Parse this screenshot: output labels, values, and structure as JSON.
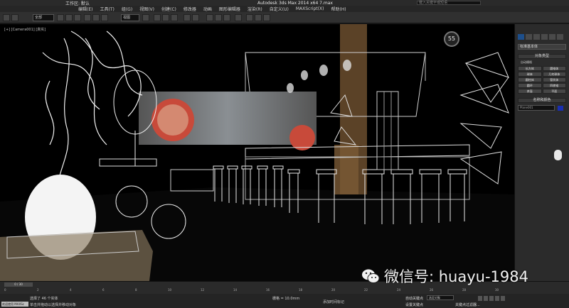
{
  "titlebar": {
    "workspace": "工作区: 默认",
    "title": "Autodesk 3ds Max 2014 x64   7.max",
    "search_placeholder": "键入关键字或短语"
  },
  "menu": {
    "items": [
      "编辑(E)",
      "工具(T)",
      "组(G)",
      "视图(V)",
      "创建(C)",
      "修改器",
      "动画",
      "图形编辑器",
      "渲染(R)",
      "自定义(U)",
      "MAXScript(X)",
      "帮助(H)"
    ]
  },
  "toolbar": {
    "selection_filter": "全部",
    "view_label": "视图"
  },
  "viewport": {
    "label": "[+] [Camera001] [真实]",
    "compass_value": "55"
  },
  "command_panel": {
    "category_dropdown": "标准基本体",
    "rollout_object_type": "对象类型",
    "autogrid": "自动栅格",
    "buttons": [
      "长方体",
      "圆锥体",
      "球体",
      "几何球体",
      "圆柱体",
      "管状体",
      "圆环",
      "四棱锥",
      "茶壶",
      "平面"
    ],
    "rollout_name_color": "名称和颜色",
    "name_value": "Plane001",
    "color": "#1a2fb0"
  },
  "timeline": {
    "frame_readout": "0 / 30",
    "ticks": [
      "0",
      "2",
      "4",
      "6",
      "8",
      "10",
      "12",
      "14",
      "16",
      "18",
      "20",
      "22",
      "24",
      "26",
      "28",
      "30"
    ]
  },
  "status": {
    "maxscript_label": "欢迎使用 MAXSc",
    "selected_count": "选择了 46 个实体",
    "prompt": "单击并拖动以选择并移动对象",
    "grid": "栅格 = 10.0mm",
    "add_time_tag": "添加时间标记",
    "auto_key": "自动关键点",
    "selected_object": "选定对象",
    "set_key": "设置关键点",
    "key_filters": "关键点过滤器..."
  },
  "watermark": {
    "text": "微信号: huayu-1984"
  }
}
